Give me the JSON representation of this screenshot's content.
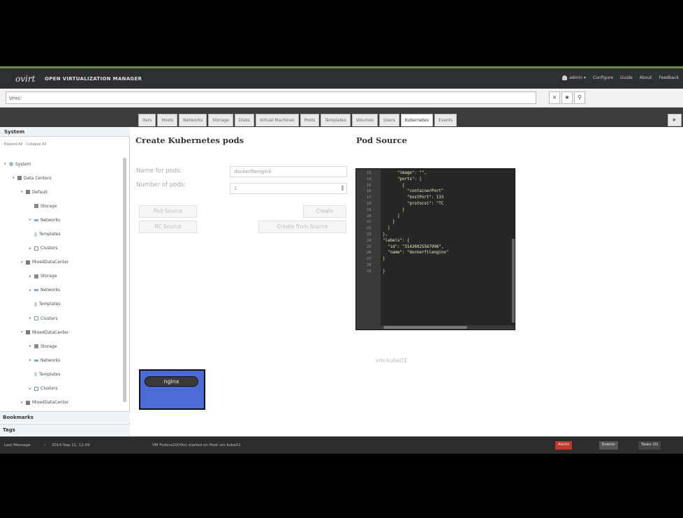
{
  "header": {
    "logo": "ovirt",
    "product": "OPEN VIRTUALIZATION MANAGER",
    "links": [
      "admin",
      "Configure",
      "Guide",
      "About",
      "Feedback"
    ]
  },
  "search": {
    "value": "Vms:"
  },
  "tabs": [
    "iters",
    "Hosts",
    "Networks",
    "Storage",
    "Disks",
    "Virtual Machines",
    "Pools",
    "Templates",
    "Volumes",
    "Users",
    "Kubernetes",
    "Events"
  ],
  "left": {
    "title": "System",
    "expand_all": "Expand All",
    "collapse_all": "Collapse All",
    "tree": [
      {
        "label": "System",
        "level": 0,
        "icon": "globe",
        "toggle": "▾"
      },
      {
        "label": "Data Centers",
        "level": 1,
        "icon": "dc",
        "toggle": "▾"
      },
      {
        "label": "Default",
        "level": 2,
        "icon": "dc",
        "toggle": "▾"
      },
      {
        "label": "Storage",
        "level": 3,
        "icon": "stor",
        "toggle": ""
      },
      {
        "label": "Networks",
        "level": 3,
        "icon": "net",
        "toggle": "▸"
      },
      {
        "label": "Templates",
        "level": 3,
        "icon": "tmpl",
        "toggle": ""
      },
      {
        "label": "Clusters",
        "level": 3,
        "icon": "clus",
        "toggle": "▸"
      },
      {
        "label": "MixedDataCenter",
        "level": 2,
        "icon": "dc",
        "toggle": "▾"
      },
      {
        "label": "Storage",
        "level": 3,
        "icon": "stor",
        "toggle": "▸"
      },
      {
        "label": "Networks",
        "level": 3,
        "icon": "net",
        "toggle": "▸"
      },
      {
        "label": "Templates",
        "level": 3,
        "icon": "tmpl",
        "toggle": ""
      },
      {
        "label": "Clusters",
        "level": 3,
        "icon": "clus",
        "toggle": "▸"
      },
      {
        "label": "MixedDataCenter",
        "level": 2,
        "icon": "dc",
        "toggle": "▾"
      },
      {
        "label": "Storage",
        "level": 3,
        "icon": "stor",
        "toggle": "▸"
      },
      {
        "label": "Networks",
        "level": 3,
        "icon": "net",
        "toggle": "▸"
      },
      {
        "label": "Templates",
        "level": 3,
        "icon": "tmpl",
        "toggle": ""
      },
      {
        "label": "Clusters",
        "level": 3,
        "icon": "clus",
        "toggle": "▸"
      },
      {
        "label": "MixedDataCenter",
        "level": 2,
        "icon": "dc",
        "toggle": "▾"
      }
    ],
    "bookmarks": "Bookmarks",
    "tags": "Tags"
  },
  "main": {
    "create_title": "Create Kubernetes pods",
    "source_title": "Pod Source",
    "name_label": "Name for pods:",
    "name_value": "dockerfilenginx",
    "number_label": "Number of pods:",
    "number_value": "1",
    "buttons": {
      "pod_source": "Pod Source",
      "rc_source": "RC Source",
      "create": "Create",
      "create_from_source": "Create from Source"
    },
    "editor": {
      "line_numbers": [
        "13",
        "14",
        "15",
        "16",
        "17",
        "18",
        "19",
        "20",
        "21",
        "22",
        "23",
        "24",
        "25",
        "26",
        "27",
        "28",
        "29"
      ],
      "lines": [
        "      \"image\": \"\",",
        "      \"ports\": [",
        "        {",
        "          \"containerPort\"",
        "          \"hostPort\": 133",
        "          \"protocol\": \"TC",
        "        }",
        "      ]",
        "    }",
        "  ]",
        "},",
        "\"labels\": {",
        "  \"id\": \"31426025567996\",",
        "  \"name\": \"dockerfilenginx\"",
        "}",
        "",
        "}"
      ]
    },
    "vm_label": "vm-kube01",
    "pod_label": "nginx"
  },
  "status": {
    "last_message_label": "Last Message:",
    "timestamp": "2014-Sep-11, 12:09",
    "message": "VM Fedora20(YAs) started on Host vm-kube01",
    "alerts": "Alerts",
    "events": "Events",
    "tasks": "Tasks (0)",
    "colors": {
      "alerts": "#c0392b",
      "events": "#555555",
      "tasks": "#444444"
    }
  }
}
